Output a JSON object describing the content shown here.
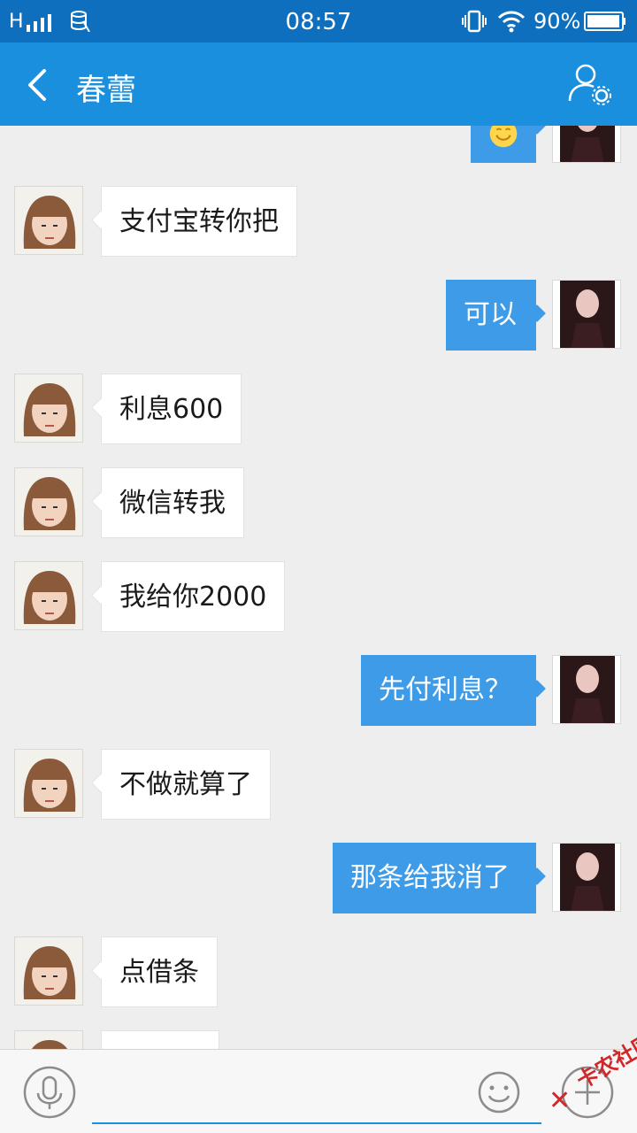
{
  "status_bar": {
    "network": "H",
    "time": "08:57",
    "battery": "90%",
    "icons": [
      "signal-icon",
      "data-icon",
      "vibrate-icon",
      "wifi-icon",
      "battery-icon"
    ]
  },
  "header": {
    "title": "春蕾",
    "back_icon": "back-arrow-icon",
    "profile_icon": "user-settings-icon"
  },
  "messages": [
    {
      "side": "right",
      "text": "😊",
      "partial": true
    },
    {
      "side": "left",
      "text": "支付宝转你把"
    },
    {
      "side": "right",
      "text": "可以"
    },
    {
      "side": "left",
      "text": "利息600"
    },
    {
      "side": "left",
      "text": "微信转我"
    },
    {
      "side": "left",
      "text": "我给你2000"
    },
    {
      "side": "right",
      "text": "先付利息？"
    },
    {
      "side": "left",
      "text": "不做就算了"
    },
    {
      "side": "right",
      "text": "那条给我消了"
    },
    {
      "side": "left",
      "text": "点借条"
    },
    {
      "side": "left",
      "text": "",
      "partial": true
    }
  ],
  "input_bar": {
    "mic_icon": "microphone-icon",
    "input_value": "",
    "emoji_icon": "emoji-icon",
    "plus_icon": "plus-icon"
  },
  "watermark": {
    "text": "卡农社区",
    "mark": "✕"
  },
  "colors": {
    "status_bar": "#0f6fbf",
    "header": "#1a8fdd",
    "bubble_sent": "#3e9be8",
    "bubble_received": "#ffffff",
    "background": "#eeeeee"
  }
}
